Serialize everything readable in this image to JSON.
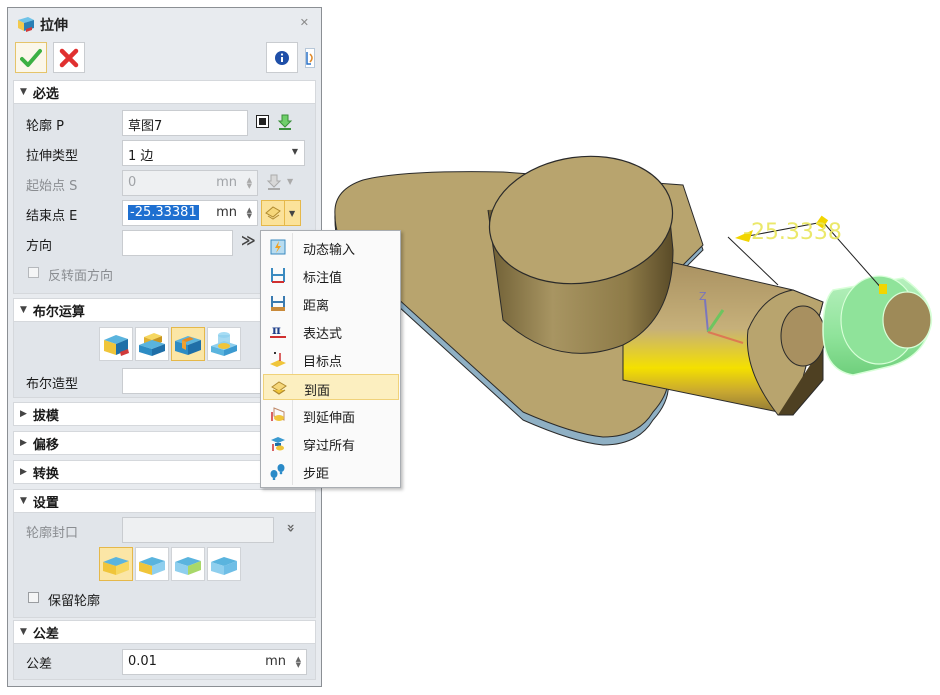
{
  "window": {
    "title": "拉伸",
    "close_icon": "close-x-icon",
    "ok_icon": "checkmark-icon",
    "cancel_icon": "red-x-icon",
    "info_icon": "info-icon"
  },
  "sections": {
    "required": {
      "title": "必选",
      "expanded": true,
      "profile": {
        "label": "轮廓 P",
        "value": "草图7"
      },
      "extrude_type": {
        "label": "拉伸类型",
        "value": "1 边"
      },
      "start_point": {
        "label": "起始点 S",
        "value": "0",
        "unit": "mn",
        "disabled": true
      },
      "end_point": {
        "label": "结束点 E",
        "value": "-25.33381",
        "unit": "mn"
      },
      "direction": {
        "label": "方向",
        "value": ""
      },
      "reverse_face": {
        "label": "反转面方向",
        "checked": false,
        "disabled": true
      }
    },
    "boolean": {
      "title": "布尔运算",
      "expanded": true,
      "ops": [
        "boolean-base-icon",
        "boolean-add-icon",
        "boolean-subtract-icon",
        "boolean-intersect-icon"
      ],
      "active_index": 2,
      "shape_label": "布尔造型",
      "shape_value": ""
    },
    "draft": {
      "title": "拔模",
      "expanded": false
    },
    "offset": {
      "title": "偏移",
      "expanded": false
    },
    "transform": {
      "title": "转换",
      "expanded": false
    },
    "settings": {
      "title": "设置",
      "expanded": true,
      "profile_cap_label": "轮廓封口",
      "profile_cap_value": "",
      "cap_options": [
        "cap-both-icon",
        "cap-start-icon",
        "cap-end-icon",
        "cap-none-icon"
      ],
      "active_cap_index": 0,
      "keep_profile": {
        "label": "保留轮廓",
        "checked": false
      }
    },
    "tolerance": {
      "title": "公差",
      "expanded": true,
      "label": "公差",
      "value": "0.01",
      "unit": "mn"
    }
  },
  "dropdown_menu": {
    "items": [
      {
        "label": "动态输入",
        "icon": "dynamic-input-icon"
      },
      {
        "label": "标注值",
        "icon": "dimension-value-icon"
      },
      {
        "label": "距离",
        "icon": "distance-icon"
      },
      {
        "label": "表达式",
        "icon": "expression-pi-icon"
      },
      {
        "label": "目标点",
        "icon": "target-point-icon"
      },
      {
        "label": "到面",
        "icon": "to-face-icon"
      },
      {
        "label": "到延伸面",
        "icon": "to-extended-face-icon"
      },
      {
        "label": "穿过所有",
        "icon": "through-all-icon"
      },
      {
        "label": "步距",
        "icon": "step-footprints-icon"
      }
    ],
    "highlighted_index": 5
  },
  "viewport": {
    "dimension_label": "-25.3338",
    "colors": {
      "part": "#b8a46e",
      "part_dark": "#6e5e34",
      "edge": "#8fb0c4",
      "preview": "#8fe39a",
      "highlight": "#f2d500",
      "dimension": "#e9e65a"
    }
  }
}
